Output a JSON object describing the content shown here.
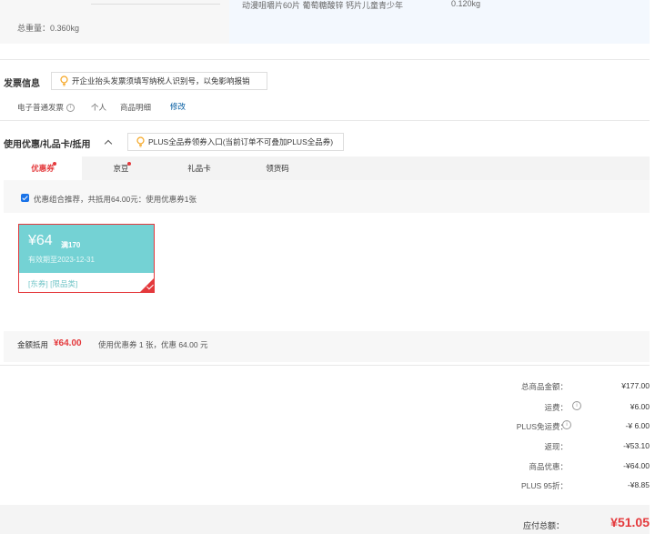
{
  "product": {
    "total_weight": "总重量：0.360kg",
    "name": "动漫咀嚼片60片 葡萄糖酸锌 钙片儿童青少年",
    "weight": "0.120kg"
  },
  "invoice": {
    "title": "发票信息",
    "tip": "开企业抬头发票须填写纳税人识别号，以免影响报销",
    "type": "电子普通发票",
    "person": "个人",
    "detail": "商品明细",
    "edit": "修改"
  },
  "coupon_section": {
    "title": "使用优惠/礼品卡/抵用",
    "plus_tip": "PLUS全品券领券入口(当前订单不可叠加PLUS全品券)",
    "tabs": [
      {
        "label": "优惠券",
        "active": true,
        "dot": true
      },
      {
        "label": "京豆",
        "active": false,
        "dot": true
      },
      {
        "label": "礼品卡",
        "active": false,
        "dot": false
      },
      {
        "label": "领货码",
        "active": false,
        "dot": false
      }
    ],
    "recommend_text": "优惠组合推荐，共抵用64.00元：使用优惠券1张",
    "coupon": {
      "amount": "¥64",
      "condition": "满170",
      "expiry": "有效期至2023-12-31",
      "tags": "[东券] [限品类]"
    },
    "deduct_label": "金额抵用",
    "deduct_value": "¥64.00",
    "deduct_detail": "使用优惠券 1 张，优惠 64.00 元"
  },
  "totals": {
    "rows": [
      {
        "label": "总商品金额：",
        "value": "¥177.00",
        "info": false,
        "accent": false
      },
      {
        "label": "运费：",
        "value": "¥6.00",
        "info": true,
        "accent": true
      },
      {
        "label": "PLUS免运费：",
        "value": "-¥ 6.00",
        "info": true,
        "accent": true
      },
      {
        "label": "返现：",
        "value": "-¥53.10",
        "info": false,
        "accent": false
      },
      {
        "label": "商品优惠：",
        "value": "-¥64.00",
        "info": false,
        "accent": false
      },
      {
        "label": "PLUS 95折：",
        "value": "-¥8.85",
        "info": false,
        "accent": false
      }
    ],
    "pay_label": "应付总额：",
    "pay_value": "¥51.05"
  },
  "colors": {
    "accent": "#e4393c",
    "coupon": "#74d2d4",
    "link": "#005aa0",
    "checkbox": "#1a73e8"
  }
}
